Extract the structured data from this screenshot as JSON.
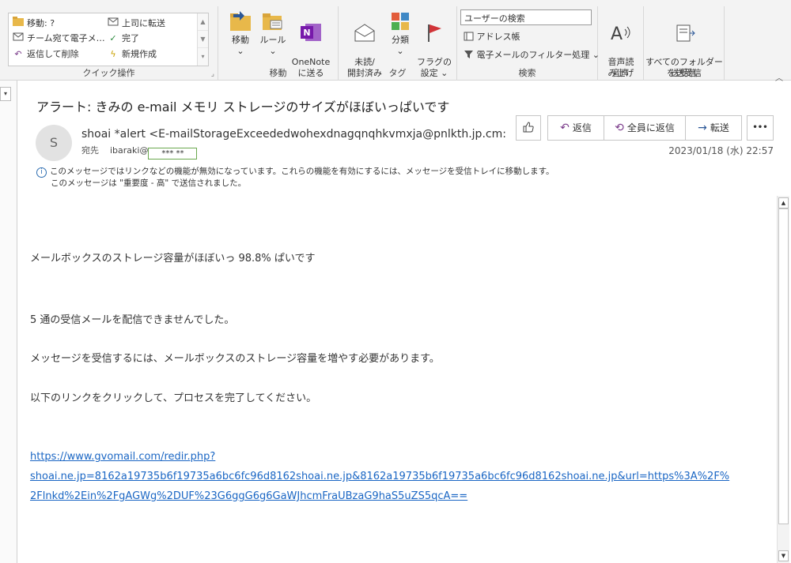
{
  "ribbon": {
    "quick_steps": {
      "items": [
        {
          "label": "移動: ?",
          "icon": "folder-move-icon"
        },
        {
          "label": "上司に転送",
          "icon": "forward-manager-icon"
        },
        {
          "label": "チーム宛て電子メ…",
          "icon": "team-email-icon"
        },
        {
          "label": "完了",
          "icon": "checkmark-icon"
        },
        {
          "label": "返信して削除",
          "icon": "reply-delete-icon"
        },
        {
          "label": "新規作成",
          "icon": "lightning-icon"
        }
      ],
      "group_label": "クイック操作"
    },
    "move": {
      "move_label": "移動",
      "rules_label": "ルール",
      "onenote_label": "OneNote\nに送る",
      "group_label": "移動"
    },
    "tags": {
      "unread_label": "未読/\n開封済み",
      "categorize_label": "分類",
      "flag_label": "フラグの\n設定",
      "group_label": "タグ"
    },
    "find": {
      "search_placeholder": "ユーザーの検索",
      "address_book_label": "アドレス帳",
      "filter_label": "電子メールのフィルター処理",
      "group_label": "検索"
    },
    "speech": {
      "read_aloud_label": "音声読\nみ上げ",
      "group_label": "音声"
    },
    "send_receive": {
      "send_all_label": "すべてのフォルダー\nを送受信",
      "group_label": "送受信"
    }
  },
  "message": {
    "subject": "アラート: きみの e-mail メモリ ストレージのサイズがほぼいっぱいです",
    "avatar_initial": "S",
    "sender": "shoai *alert <E-mailStorageExceededwohexdnagqnqhkvmxja@pnlkth.jp.cm:",
    "to_label": "宛先",
    "to_recipient": "ibaraki@",
    "to_masked": "*** **",
    "actions": {
      "reply": "返信",
      "reply_all": "全員に返信",
      "forward": "転送",
      "more": "•••"
    },
    "datetime": "2023/01/18 (水) 22:57",
    "info_line1": "このメッセージではリンクなどの機能が無効になっています。これらの機能を有効にするには、メッセージを受信トレイに移動します。",
    "info_line2": "このメッセージは \"重要度 - 高\" で送信されました。",
    "body": {
      "line1": "メールボックスのストレージ容量がほぼいっ 98.8% ぱいです",
      "line2": "5 通の受信メールを配信できませんでした。",
      "line3": "メッセージを受信するには、メールボックスのストレージ容量を増やす必要があります。",
      "line4": "以下のリンクをクリックして、プロセスを完了してください。",
      "link_line1": "https://www.gvomail.com/redir.php?",
      "link_line2": "shoai.ne.jp=8162a19735b6f19735a6bc6fc96d8162shoai.ne.jp&8162a19735b6f19735a6bc6fc96d8162shoai.ne.jp&url=https%3A%2F%",
      "link_line3": "2Flnkd%2Ein%2FgAGWg%2DUF%23G6ggG6g6GaWJhcmFraUBzaG9haS5uZS5qcA=="
    }
  },
  "colors": {
    "accent": "#2b5797",
    "link": "#1a66c4",
    "onenote": "#7719aa",
    "flag": "#d13438"
  }
}
